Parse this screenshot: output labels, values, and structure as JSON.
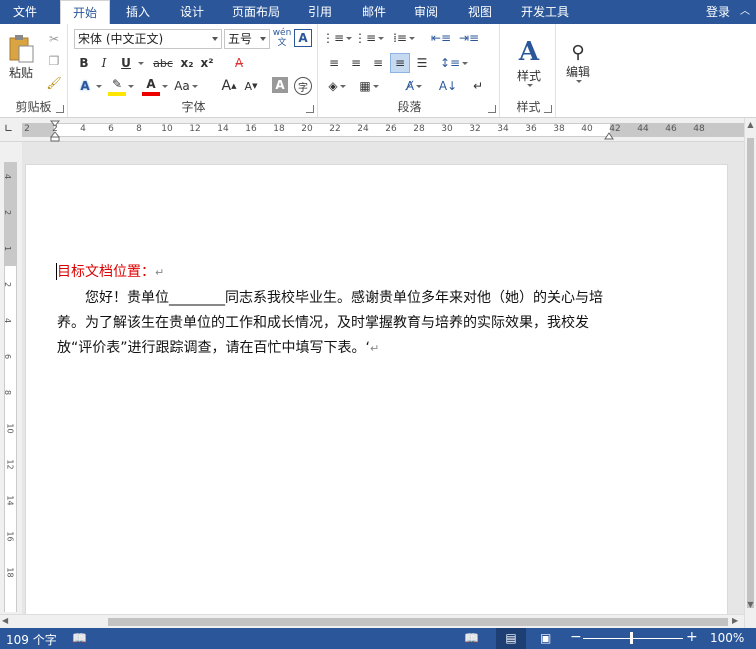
{
  "tabs": {
    "file": "文件",
    "items": [
      "开始",
      "插入",
      "设计",
      "页面布局",
      "引用",
      "邮件",
      "审阅",
      "视图",
      "开发工具"
    ],
    "login": "登录"
  },
  "ribbon": {
    "clipboard": {
      "paste_label": "粘贴",
      "group_label": "剪贴板"
    },
    "font": {
      "font_name": "宋体 (中文正文)",
      "font_size": "五号",
      "phonetic": "wén",
      "group_label": "字体",
      "bold": "B",
      "italic": "I",
      "underline": "U",
      "strike": "abc",
      "subscript": "x₂",
      "superscript": "x²",
      "grow": "A",
      "shrink": "A",
      "case": "Aa"
    },
    "paragraph": {
      "group_label": "段落"
    },
    "styles": {
      "label": "样式",
      "group_label": "样式"
    },
    "editing": {
      "label": "编辑"
    }
  },
  "ruler": {
    "h_ticks": [
      "2",
      "2",
      "4",
      "6",
      "8",
      "10",
      "12",
      "14",
      "16",
      "18",
      "20",
      "22",
      "24",
      "26",
      "28",
      "30",
      "32",
      "34",
      "36",
      "38",
      "40",
      "42",
      "44",
      "46",
      "48"
    ],
    "v_ticks": [
      "4",
      "2",
      "1",
      "2",
      "4",
      "6",
      "8",
      "10",
      "12",
      "14",
      "16",
      "18"
    ]
  },
  "document": {
    "heading": "目标文档位置：",
    "body": "您好！贵单位________同志系我校毕业生。感谢贵单位多年来对他（她）的关心与培养。为了解该生在贵单位的工作和成长情况，及时掌握教育与培养的实际效果，我校发放“评价表”进行跟踪调查，请在百忙中填写下表。‘",
    "para_mark": "↵"
  },
  "status": {
    "word_count": "109 个字",
    "zoom": "100%"
  },
  "colors": {
    "brand": "#2b579a",
    "heading_red": "#dd0000"
  }
}
